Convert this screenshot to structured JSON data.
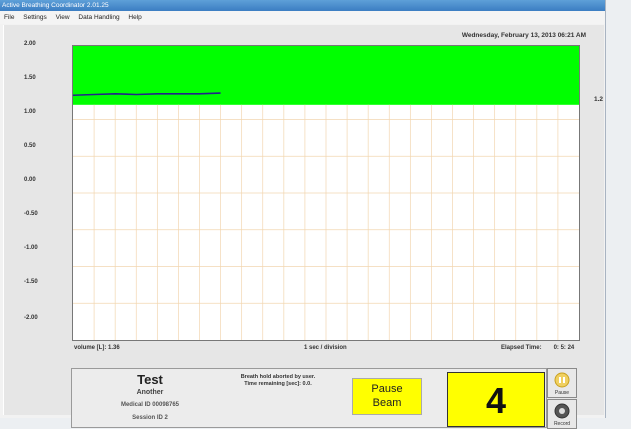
{
  "window": {
    "title": "Active Breathing Coordinator  2.01.25"
  },
  "menu": [
    "File",
    "Settings",
    "View",
    "Data Handling",
    "Help"
  ],
  "header": {
    "datetime": "Wednesday, February 13, 2013   06:21 AM"
  },
  "chart_data": {
    "type": "line",
    "ylabel": "",
    "xlabel": "1 sec / division",
    "ylim": [
      -2.0,
      2.0
    ],
    "yticks": [
      "2.00",
      "1.50",
      "1.00",
      "0.50",
      "0.00",
      "-0.50",
      "-1.00",
      "-1.50",
      "-2.00"
    ],
    "x_divisions": 24,
    "gating_band": {
      "lower": 1.2,
      "upper": 2.0,
      "color": "#00ff00"
    },
    "series": [
      {
        "color": "#22258a",
        "x": [
          0,
          1,
          2,
          3,
          4,
          5,
          6,
          7
        ],
        "y": [
          1.33,
          1.34,
          1.35,
          1.34,
          1.35,
          1.35,
          1.35,
          1.36
        ]
      }
    ],
    "side_value": "1.2"
  },
  "status": {
    "volume": "volume [L]:  1.36",
    "division": "1 sec / division",
    "elapsed_label": "Elapsed Time:",
    "elapsed_value": "0: 5: 24"
  },
  "patient": {
    "name": "Test",
    "second_name": "Another",
    "medical_id": "Medical ID 00098765",
    "session_id": "Session ID 2"
  },
  "message": {
    "line1": "Breath hold aborted by user.",
    "line2": "Time remaining [sec]: 0.0."
  },
  "beam": {
    "line1": "Pause",
    "line2": "Beam"
  },
  "counter": "4",
  "buttons": {
    "pause": "Pause",
    "record": "Record"
  }
}
